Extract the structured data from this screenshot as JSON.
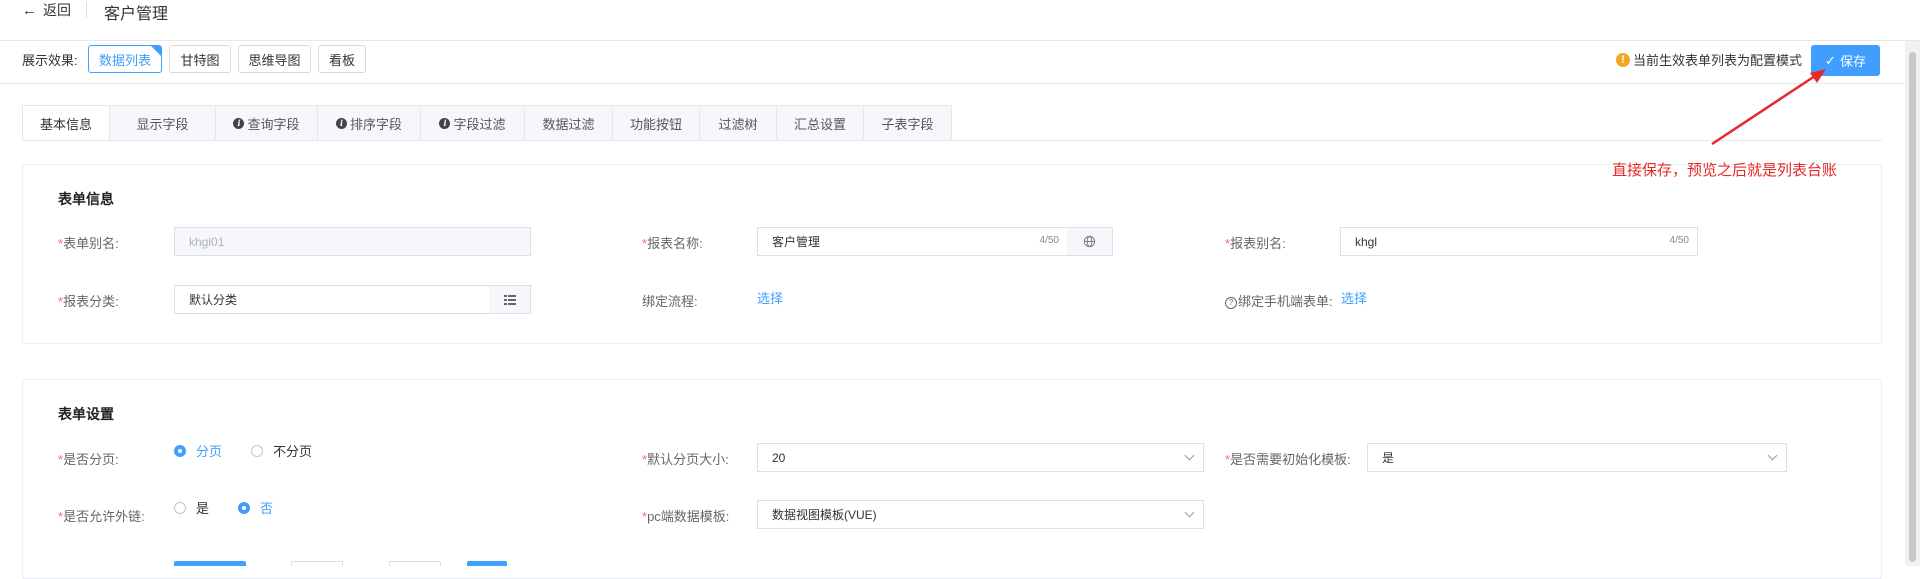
{
  "header": {
    "back_label": "返回",
    "title": "客户管理"
  },
  "toolbar": {
    "show_label": "展示效果:",
    "modes": [
      "数据列表",
      "甘特图",
      "思维导图",
      "看板"
    ],
    "active_mode": "数据列表",
    "notice": "当前生效表单列表为配置模式",
    "save_label": "保存"
  },
  "tabs": [
    {
      "label": "基本信息",
      "active": true,
      "icon": false
    },
    {
      "label": "显示字段",
      "active": false,
      "icon": false
    },
    {
      "label": "查询字段",
      "active": false,
      "icon": true
    },
    {
      "label": "排序字段",
      "active": false,
      "icon": true
    },
    {
      "label": "字段过滤",
      "active": false,
      "icon": true
    },
    {
      "label": "数据过滤",
      "active": false,
      "icon": false
    },
    {
      "label": "功能按钮",
      "active": false,
      "icon": false
    },
    {
      "label": "过滤树",
      "active": false,
      "icon": false
    },
    {
      "label": "汇总设置",
      "active": false,
      "icon": false
    },
    {
      "label": "子表字段",
      "active": false,
      "icon": false
    }
  ],
  "form_info": {
    "title": "表单信息",
    "form_alias": {
      "label": "表单别名:",
      "value": "khgl01"
    },
    "report_name": {
      "label": "报表名称:",
      "value": "客户管理",
      "counter": "4/50"
    },
    "report_alias": {
      "label": "报表别名:",
      "value": "khgl",
      "counter": "4/50"
    },
    "report_category": {
      "label": "报表分类:",
      "value": "默认分类"
    },
    "bind_flow": {
      "label": "绑定流程:",
      "link": "选择"
    },
    "bind_mobile": {
      "label": "绑定手机端表单:",
      "link": "选择"
    }
  },
  "form_settings": {
    "title": "表单设置",
    "paging": {
      "label": "是否分页:",
      "options": [
        "分页",
        "不分页"
      ],
      "selected": "分页"
    },
    "page_size": {
      "label": "默认分页大小:",
      "value": "20"
    },
    "init_template": {
      "label": "是否需要初始化模板:",
      "value": "是"
    },
    "external_link": {
      "label": "是否允许外链:",
      "options": [
        "是",
        "否"
      ],
      "selected": "否"
    },
    "pc_template": {
      "label": "pc端数据模板:",
      "value": "数据视图模板(VUE)"
    }
  },
  "annotation": {
    "text": "直接保存，预览之后就是列表台账"
  },
  "colors": {
    "primary": "#409eff",
    "annotation": "#e62828",
    "required": "#f56c6c",
    "warning": "#f5a623"
  }
}
